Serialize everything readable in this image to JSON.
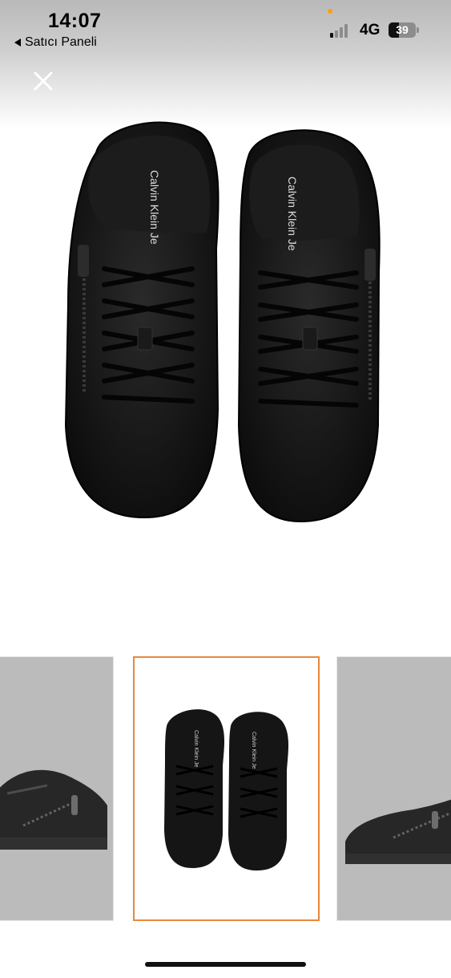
{
  "status_bar": {
    "time": "14:07",
    "back_label": "Satıcı Paneli",
    "network": "4G",
    "battery": "39",
    "battery_fraction": 0.39,
    "signal_bars_filled": 1,
    "signal_bars_total": 4
  },
  "viewer": {
    "close_icon": "close-icon",
    "main_image_brand_text": "Calvin Klein Je",
    "selected_thumbnail_index": 1,
    "thumbnails": [
      {
        "view": "side-left",
        "selected": false
      },
      {
        "view": "top",
        "selected": true
      },
      {
        "view": "side-right",
        "selected": false
      }
    ]
  },
  "colors": {
    "accent_border": "#e8883a",
    "recording_dot": "#ff9f0a",
    "shoe": "#141414"
  }
}
